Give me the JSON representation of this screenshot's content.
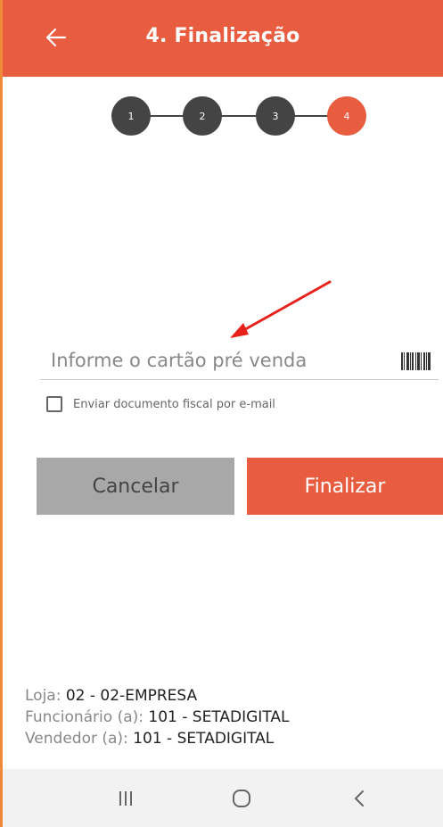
{
  "header": {
    "title": "4. Finalização"
  },
  "stepper": {
    "steps": [
      "1",
      "2",
      "3",
      "4"
    ],
    "active_step": 4
  },
  "card_input": {
    "placeholder": "Informe o cartão pré venda",
    "value": ""
  },
  "checkbox": {
    "label": "Enviar documento fiscal por e-mail",
    "checked": false
  },
  "buttons": {
    "cancel_label": "Cancelar",
    "finalize_label": "Finalizar"
  },
  "info": {
    "store_label": "Loja:",
    "store_value": "02 - 02-EMPRESA",
    "employee_label": "Funcionário (a):",
    "employee_value": "101 - SETADIGITAL",
    "seller_label": "Vendedor (a):",
    "seller_value": "101 - SETADIGITAL"
  },
  "icons": {
    "back": "arrow-left-icon",
    "barcode": "barcode-icon",
    "nav_recents": "recents-icon",
    "nav_home": "home-icon",
    "nav_back": "chevron-left-icon"
  },
  "colors": {
    "accent": "#e85c40",
    "step_inactive": "#444444",
    "cancel_bg": "#a8a8a8",
    "left_border": "#ef8a3a",
    "annotation_arrow": "#e8221b"
  }
}
